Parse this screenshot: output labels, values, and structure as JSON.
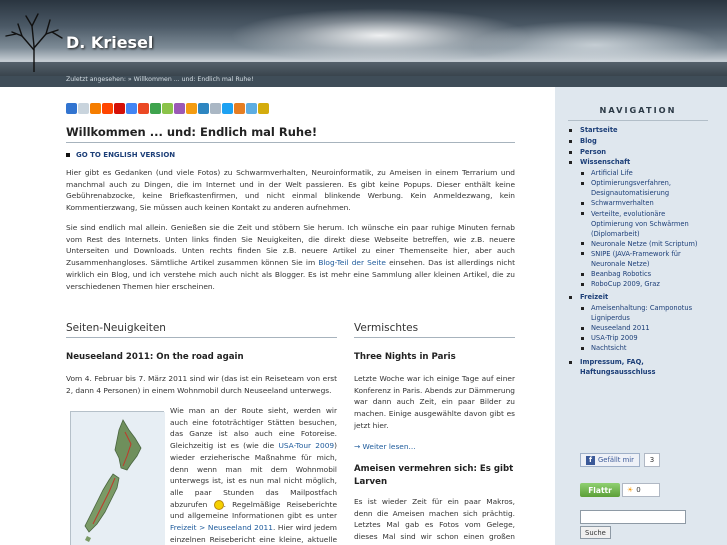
{
  "header": {
    "site_title": "D. Kriesel",
    "breadcrumb": "Zuletzt angesehen: » Willkommen ... und: Endlich mal Ruhe!"
  },
  "share_icons": [
    "delicious-icon",
    "digg-icon",
    "blogger-icon",
    "reddit-icon",
    "lastfm-icon",
    "google-icon",
    "stumble-icon",
    "technorati-icon",
    "mixx-icon",
    "furl-icon",
    "feed-icon",
    "bookmark-icon",
    "copy-icon",
    "twitter-icon",
    "plus-icon",
    "share-icon",
    "home-icon"
  ],
  "post": {
    "title": "Willkommen ... und: Endlich mal Ruhe!",
    "english_link": "GO TO ENGLISH VERSION",
    "para1": "Hier gibt es Gedanken (und viele Fotos) zu Schwarmverhalten, Neuroinformatik, zu Ameisen in einem Terrarium und manchmal auch zu Dingen, die im Internet und in der Welt passieren. Es gibt keine Popups. Dieser enthält keine Gebührenabzocke, keine Briefkastenfirmen, und nicht einmal blinkende Werbung. Kein Anmeldezwang, kein Kommentierzwang, Sie müssen auch keinen Kontakt zu anderen aufnehmen.",
    "para2_a": "Sie sind endlich mal allein. Genießen sie die Zeit und stöbern Sie herum. Ich wünsche ein paar ruhige Minuten fernab vom Rest des Internets. Unten links finden Sie Neuigkeiten, die direkt diese Webseite betreffen, wie z.B. neuere Unterseiten und Downloads. Unten rechts finden Sie z.B. neuere Artikel zu einer Themenseite hier, aber auch Zusammenhangloses. Sämtliche Artikel zusammen können Sie im ",
    "para2_link": "Blog-Teil der Seite",
    "para2_b": " einsehen. Das ist allerdings nicht wirklich ein Blog, und ich verstehe mich auch nicht als Blogger. Es ist mehr eine Sammlung aller kleinen Artikel, die zu verschiedenen Themen hier erscheinen."
  },
  "left_col": {
    "heading": "Seiten-Neuigkeiten",
    "article_title": "Neuseeland 2011: On the road again",
    "article_intro": "Vom 4. Februar bis 7. März 2011 sind wir (das ist ein Reiseteam von erst 2, dann 4 Personen) in einem Wohnmobil durch Neuseeland unterwegs.",
    "article_body_a": "Wie man an der Route sieht, werden wir auch eine fototrächtiger Stätten besuchen, das Ganze ist also auch eine Fotoreise. Gleichzeitig ist es (wie die ",
    "article_link1": "USA-Tour 2009",
    "article_body_b": ") wieder erzieherische Maßnahme für mich, denn wenn man mit dem Wohnmobil unterwegs ist, ist es nun mal nicht möglich, alle paar Stunden das Mailpostfach abzurufen ",
    "article_body_c": ". Regelmäßige Reiseberichte und allgemeine Informationen gibt es unter ",
    "article_link2": "Freizeit > Neuseeland 2011",
    "article_body_d": ". Hier wird jedem einzelnen Reisebericht eine kleine, aktuelle Bildergalerie"
  },
  "right_col": {
    "heading": "Vermischtes",
    "article1_title": "Three Nights in Paris",
    "article1_body": "Letzte Woche war ich einige Tage auf einer Konferenz in Paris. Abends zur Dämmerung war dann auch Zeit, ein paar Bilder zu machen. Einige ausgewählte davon gibt es jetzt hier.",
    "article1_more": "→ Weiter lesen...",
    "article2_title": "Ameisen vermehren sich: Es gibt Larven",
    "article2_body": "Es ist wieder Zeit für ein paar Makros, denn die Ameisen machen sich prächtig. Letztes Mal gab es Fotos vom Gelege, dieses Mal sind wir schon einen großen Schritt weiter:"
  },
  "sidebar": {
    "nav_title": "NAVIGATION",
    "items": [
      {
        "label": "Startseite"
      },
      {
        "label": "Blog"
      },
      {
        "label": "Person"
      },
      {
        "label": "Wissenschaft"
      }
    ],
    "wissenschaft_sub": [
      "Artificial Life",
      "Optimierungsverfahren, Designautomatisierung",
      "Schwarmverhalten",
      "Verteilte, evolutionäre Optimierung von Schwärmen (Diplomarbeit)",
      "Neuronale Netze (mit Scriptum)",
      "SNIPE (JAVA-Framework für Neuronale Netze)",
      "Beanbag Robotics",
      "RoboCup 2009, Graz"
    ],
    "freizeit_label": "Freizeit",
    "freizeit_sub": [
      "Ameisenhaltung: Camponotus Ligniperdus",
      "Neuseeland 2011",
      "USA-Trip 2009",
      "Nachtsicht"
    ],
    "impressum_label": "Impressum, FAQ, Haftungsausschluss",
    "fb_like": "Gefällt mir",
    "fb_count": "3",
    "flattr_label": "Flattr",
    "flattr_count": "0",
    "search_button": "Suche"
  }
}
